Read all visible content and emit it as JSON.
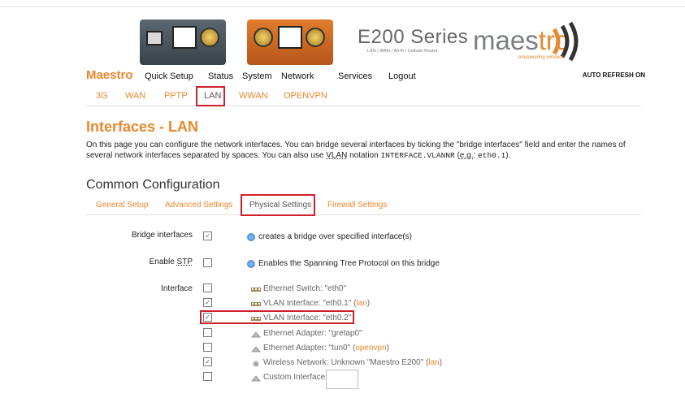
{
  "banner": {
    "series_title": "E200 Series",
    "series_sub": "LAN / WAN / Wi-Fi / Cellular Router",
    "brand_logo_prefix": "maes",
    "brand_logo_suffix": "tro",
    "brand_sub": "empowering wireless"
  },
  "nav": {
    "brand": "Maestro",
    "items": [
      "Quick Setup",
      "Status",
      "System",
      "Network",
      "Services",
      "Logout"
    ],
    "auto_refresh": "AUTO REFRESH ON"
  },
  "subnav": {
    "items": [
      "3G",
      "WAN",
      "PPTP",
      "LAN",
      "WWAN",
      "OPENVPN"
    ],
    "active": "LAN"
  },
  "page": {
    "title": "Interfaces - LAN",
    "desc_part1": "On this page you can configure the network interfaces. You can bridge several interfaces by ticking the \"bridge interfaces\" field and enter the names of several network interfaces separated by spaces. You can also use ",
    "desc_abbr": "VLAN",
    "desc_part2": " notation ",
    "desc_code1": "INTERFACE.VLANNR",
    "desc_part3": " (",
    "desc_eg": "e.g.",
    "desc_part4": ": ",
    "desc_code2": "eth0.1",
    "desc_part5": ")."
  },
  "section": {
    "title": "Common Configuration",
    "tabs": [
      "General Setup",
      "Advanced Settings",
      "Physical Settings",
      "Firewall Settings"
    ],
    "active_tab": "Physical Settings"
  },
  "form": {
    "bridge_label": "Bridge interfaces",
    "bridge_checked": true,
    "bridge_hint": "creates a bridge over specified interface(s)",
    "stp_label_prefix": "Enable ",
    "stp_abbr": "STP",
    "stp_checked": false,
    "stp_hint": "Enables the Spanning Tree Protocol on this bridge",
    "interface_label": "Interface",
    "interfaces": [
      {
        "text": "Ethernet Switch: \"eth0\"",
        "suffix": "",
        "checked": false,
        "icon": "ethernet-switch-icon"
      },
      {
        "text": "VLAN Interface: \"eth0.1\" (",
        "suffix": "lan",
        "end": ")",
        "checked": true,
        "icon": "vlan-icon"
      },
      {
        "text": "VLAN Interface: \"eth0.2\"",
        "suffix": "",
        "checked": true,
        "icon": "vlan-icon"
      },
      {
        "text": "Ethernet Adapter: \"gretap0\"",
        "suffix": "",
        "checked": false,
        "icon": "ethernet-adapter-icon"
      },
      {
        "text": "Ethernet Adapter: \"tun0\" (",
        "suffix": "openvpn",
        "end": ")",
        "checked": false,
        "icon": "ethernet-adapter-icon"
      },
      {
        "text": "Wireless Network: Unknown \"Maestro E200\" (",
        "suffix": "lan",
        "end": ")",
        "checked": true,
        "icon": "wireless-icon"
      },
      {
        "text": "Custom Interface:",
        "suffix": "",
        "checked": false,
        "icon": "custom-interface-icon"
      }
    ],
    "checkmark": "✓"
  },
  "colors": {
    "accent": "#e9872c",
    "highlight_box": "#d0202b"
  }
}
